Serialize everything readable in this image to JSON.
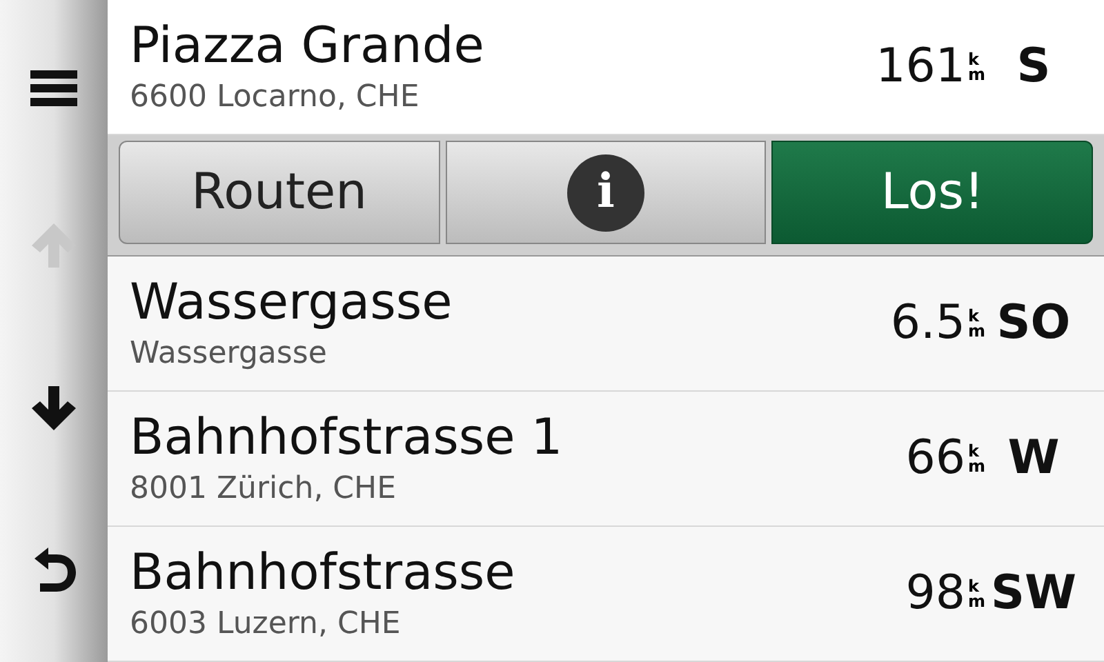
{
  "sidebar": {
    "buttons": [
      {
        "kind": "menu",
        "disabled": false
      },
      {
        "kind": "up",
        "disabled": true
      },
      {
        "kind": "down",
        "disabled": false
      },
      {
        "kind": "back",
        "disabled": false
      }
    ]
  },
  "results": [
    {
      "name": "Piazza Grande",
      "address": "6600 Locarno, CHE",
      "distance": "161",
      "unit_upper": "k",
      "unit_lower": "m",
      "direction": "S",
      "expanded": true
    },
    {
      "name": "Wassergasse",
      "address": "Wassergasse",
      "distance": "6.5",
      "unit_upper": "k",
      "unit_lower": "m",
      "direction": "SO",
      "expanded": false
    },
    {
      "name": "Bahnhofstrasse 1",
      "address": "8001 Zürich, CHE",
      "distance": "66",
      "unit_upper": "k",
      "unit_lower": "m",
      "direction": "W",
      "expanded": false
    },
    {
      "name": "Bahnhofstrasse",
      "address": "6003 Luzern, CHE",
      "distance": "98",
      "unit_upper": "k",
      "unit_lower": "m",
      "direction": "SW",
      "expanded": false
    }
  ],
  "actions": [
    {
      "kind": "text",
      "label": "Routen"
    },
    {
      "kind": "info",
      "label": "i"
    },
    {
      "kind": "go",
      "label": "Los!"
    }
  ]
}
